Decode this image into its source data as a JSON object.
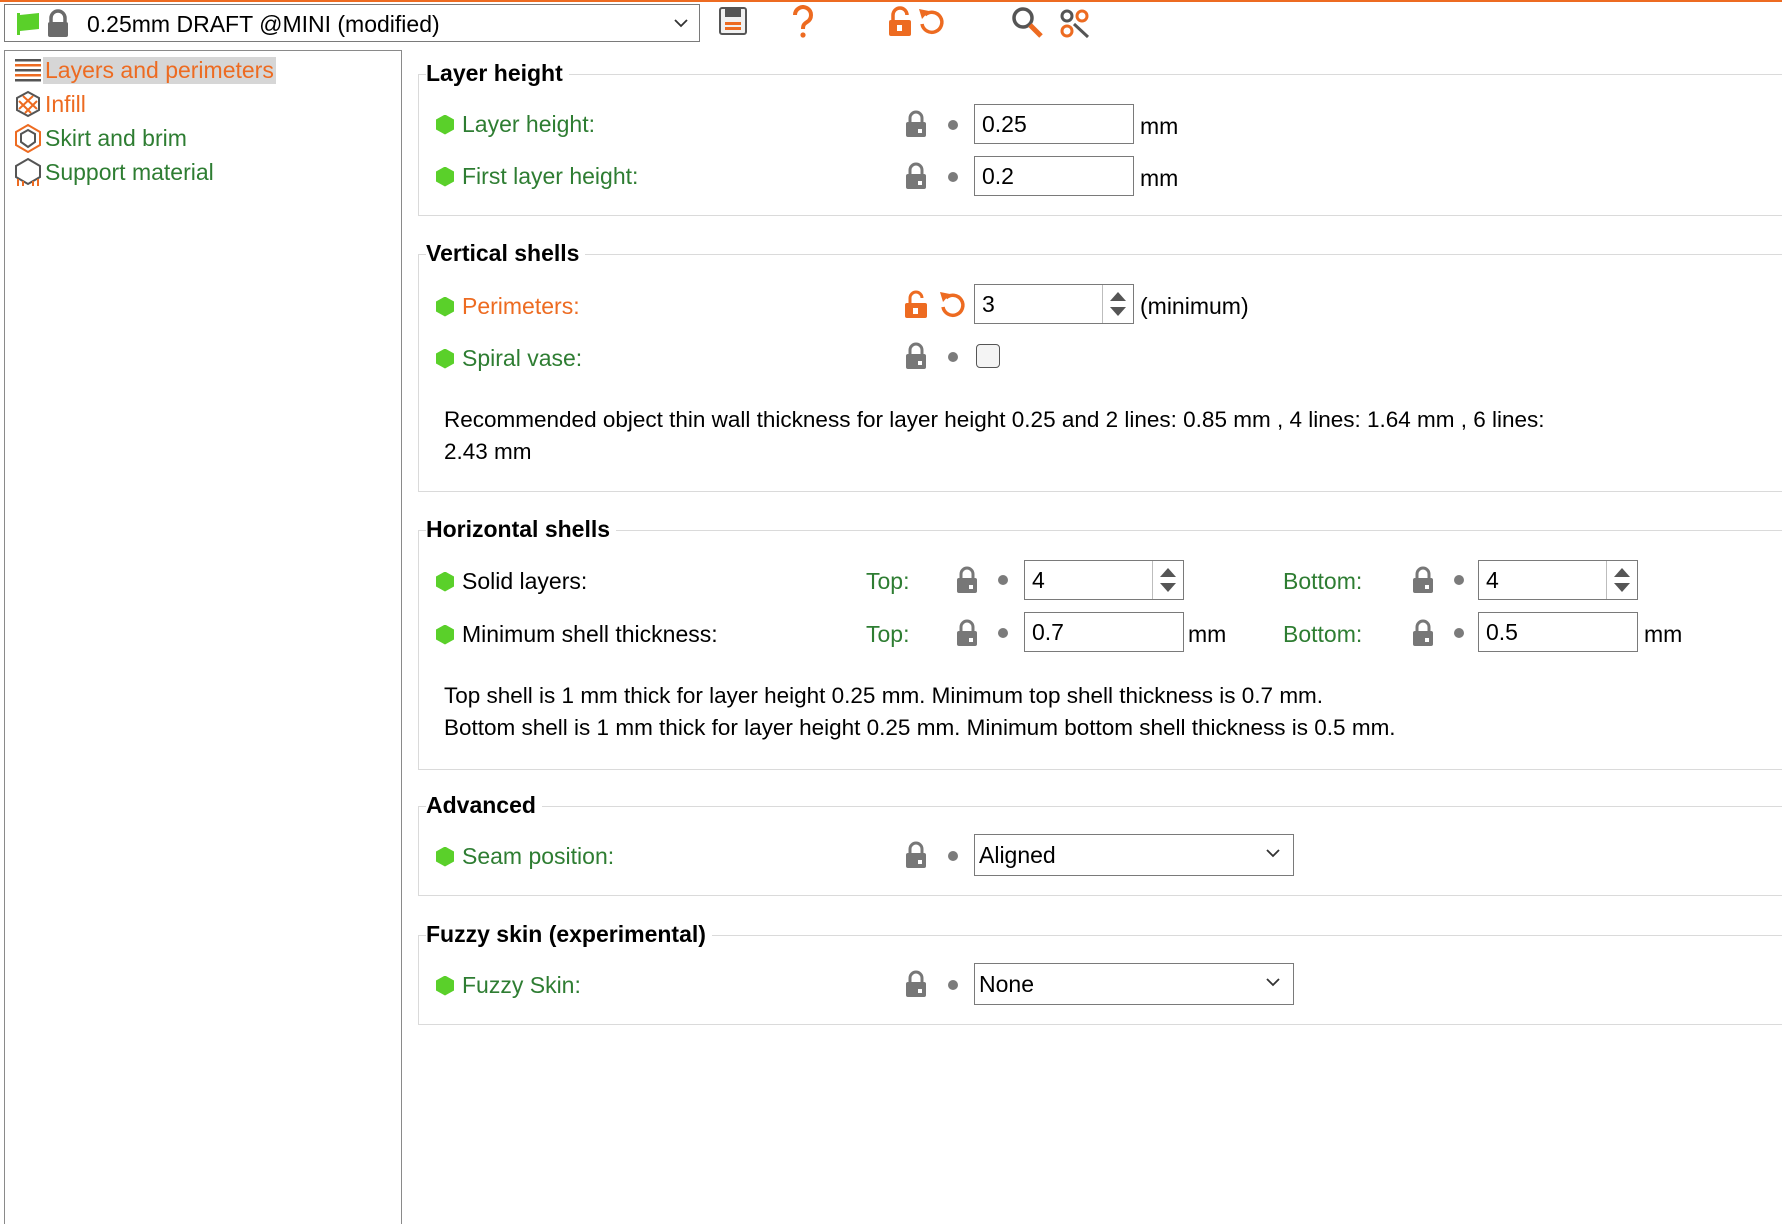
{
  "toolbar": {
    "preset_name": "0.25mm DRAFT @MINI (modified)",
    "icons": [
      "preset-flag-icon",
      "lock-icon",
      "chevron-down-icon",
      "save-icon",
      "question-icon",
      "unlock-icon",
      "undo-arrow-icon",
      "search-icon",
      "settings-gears-icon"
    ],
    "accent_color": "#ed6b21"
  },
  "sidebar": {
    "items": [
      {
        "label": "Layers and perimeters",
        "icon": "layers-icon",
        "active": true
      },
      {
        "label": "Infill",
        "icon": "infill-icon",
        "active": false
      },
      {
        "label": "Skirt and brim",
        "icon": "skirt-icon",
        "active": false
      },
      {
        "label": "Support material",
        "icon": "support-icon",
        "active": false
      }
    ]
  },
  "groups": {
    "layer_height": {
      "title": "Layer height",
      "layer_height": {
        "label": "Layer height:",
        "value": "0.25",
        "unit": "mm"
      },
      "first_layer_height": {
        "label": "First layer height:",
        "value": "0.2",
        "unit": "mm"
      }
    },
    "vertical_shells": {
      "title": "Vertical shells",
      "perimeters": {
        "label": "Perimeters:",
        "value": "3",
        "unit": "(minimum)"
      },
      "spiral_vase": {
        "label": "Spiral vase:",
        "checked": false
      },
      "note_line1": "Recommended object thin wall thickness for layer height 0.25 and 2 lines: 0.85 mm , 4 lines: 1.64 mm , 6 lines:",
      "note_line2": "2.43 mm"
    },
    "horizontal_shells": {
      "title": "Horizontal shells",
      "solid_layers": {
        "label": "Solid layers:",
        "top_label": "Top:",
        "top_value": "4",
        "bottom_label": "Bottom:",
        "bottom_value": "4"
      },
      "min_shell": {
        "label": "Minimum shell thickness:",
        "top_label": "Top:",
        "top_value": "0.7",
        "top_unit": "mm",
        "bottom_label": "Bottom:",
        "bottom_value": "0.5",
        "bottom_unit": "mm"
      },
      "note_line1": "Top shell is 1 mm thick for layer height 0.25 mm. Minimum top shell thickness is 0.7 mm.",
      "note_line2": "Bottom shell is 1 mm thick for layer height 0.25 mm. Minimum bottom shell thickness is 0.5 mm."
    },
    "advanced": {
      "title": "Advanced",
      "seam_position": {
        "label": "Seam position:",
        "value": "Aligned"
      }
    },
    "fuzzy": {
      "title": "Fuzzy skin (experimental)",
      "fuzzy_skin": {
        "label": "Fuzzy Skin:",
        "value": "None"
      }
    }
  }
}
